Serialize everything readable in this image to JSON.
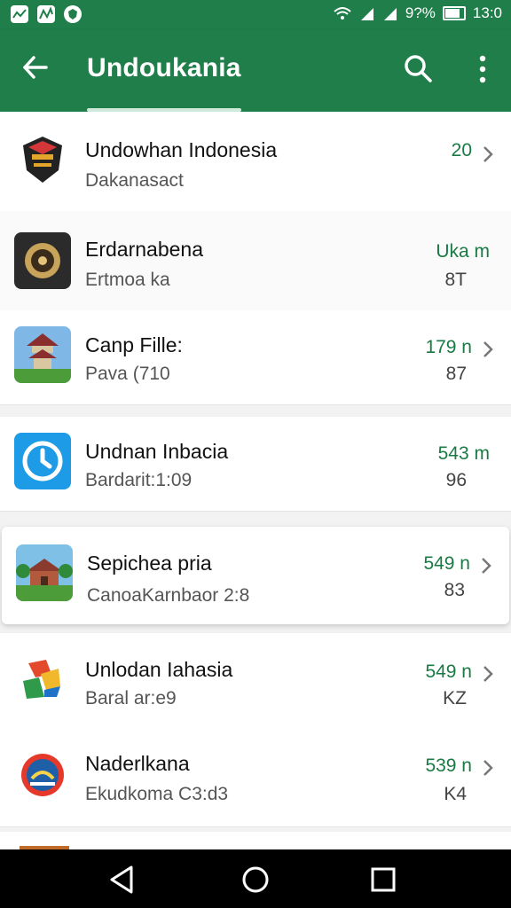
{
  "status_bar": {
    "battery_text": "9?%",
    "time": "13:0",
    "left_icons": [
      "notification-icon",
      "chart-icon",
      "shield-icon"
    ]
  },
  "app_bar": {
    "title": "Undoukania",
    "back_icon": "arrow-left-icon",
    "search_icon": "search-icon",
    "more_icon": "more-vertical-icon"
  },
  "items": [
    {
      "name": "Undowhan Indonesia",
      "subtitle": "Dakanasact",
      "meta": "20",
      "meta2": "",
      "icon": "emblem-icon",
      "color": "#1f1f1f"
    },
    {
      "name": "Erdarnabena",
      "subtitle": "Ertmoa ka",
      "meta": "Uka m",
      "meta2": "8T",
      "icon": "compass-icon",
      "color": "#2b2b2b"
    },
    {
      "name": "Canp Fille:",
      "subtitle": "Pava (710",
      "meta": "179 n",
      "meta2": "87",
      "icon": "temple-icon",
      "color": "#5aa0d8"
    },
    {
      "name": "Undnan Inbacia",
      "subtitle": "Bardarit:1:09",
      "meta": "543 m",
      "meta2": "96",
      "icon": "clock-icon",
      "color": "#1e9be6"
    },
    {
      "name": "Sepichea pria",
      "subtitle": "CanoaKarnbaor 2:8",
      "meta": "549 n",
      "meta2": "83",
      "icon": "house-icon",
      "color": "#4c9c3a"
    },
    {
      "name": "Unlodan Iahasia",
      "subtitle": "Baral ar:e9",
      "meta": "549 n",
      "meta2": "KZ",
      "icon": "map-logo-icon",
      "color": "#e24a2b"
    },
    {
      "name": "Naderlkana",
      "subtitle": "Ekudkoma C3:d3",
      "meta": "539 n",
      "meta2": "K4",
      "icon": "badge-icon",
      "color": "#1f5fa8"
    }
  ],
  "nav": {
    "back_icon": "triangle-back-icon",
    "home_icon": "circle-home-icon",
    "recents_icon": "square-recents-icon"
  }
}
